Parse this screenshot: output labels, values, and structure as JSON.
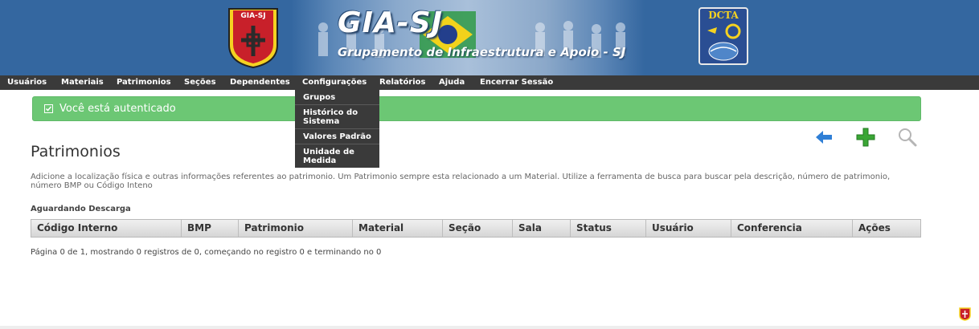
{
  "header": {
    "shield_text": "GIA-SJ",
    "title": "GIA-SJ",
    "subtitle": "Grupamento de Infraestrutura e Apoio - SJ",
    "dcta_text": "DCTA"
  },
  "nav": {
    "items": [
      {
        "label": "Usuários"
      },
      {
        "label": "Materiais"
      },
      {
        "label": "Patrimonios"
      },
      {
        "label": "Seções"
      },
      {
        "label": "Dependentes"
      },
      {
        "label": "Configurações"
      },
      {
        "label": "Relatórios"
      },
      {
        "label": "Ajuda"
      },
      {
        "label": "Encerrar Sessão"
      }
    ],
    "dropdown": [
      {
        "label": "Grupos"
      },
      {
        "label": "Histórico do Sistema"
      },
      {
        "label": "Valores Padrão"
      },
      {
        "label": "Unidade de Medida"
      }
    ]
  },
  "alert": {
    "text": "Você está autenticado"
  },
  "colors": {
    "banner": "#3467a0",
    "navbar": "#3a3a3a",
    "alert": "#6cc774",
    "back_arrow": "#2f7fd6",
    "add_plus": "#3aa635"
  },
  "actions": {
    "back_icon": "left-arrow-icon",
    "add_icon": "plus-icon",
    "search_icon": "search-icon"
  },
  "page": {
    "title": "Patrimonios",
    "description": "Adicione a localização física e outras informações referentes ao patrimonio. Um Patrimonio sempre esta relacionado a um Material. Utilize a ferramenta de busca para buscar pela descrição, número de patrimonio, número BMP ou Código Inteno",
    "section_label": "Aguardando Descarga"
  },
  "table": {
    "columns": [
      "Código Interno",
      "BMP",
      "Patrimonio",
      "Material",
      "Seção",
      "Sala",
      "Status",
      "Usuário",
      "Conferencia",
      "Ações"
    ],
    "rows": []
  },
  "pagination": {
    "text": "Página 0 de 1, mostrando 0 registros de 0, começando no registro 0 e terminando no 0"
  }
}
